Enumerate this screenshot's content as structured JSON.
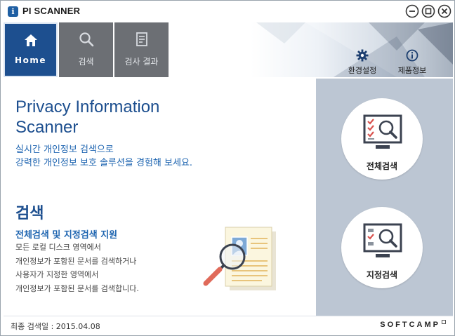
{
  "window": {
    "title": "PI SCANNER",
    "app_icon_glyph": "i"
  },
  "nav": {
    "tabs": [
      {
        "label": "Home",
        "icon": "home-icon",
        "active": true
      },
      {
        "label": "검색",
        "icon": "search-icon",
        "active": false
      },
      {
        "label": "검사 결과",
        "icon": "document-icon",
        "active": false
      }
    ]
  },
  "utilities": {
    "settings_label": "환경설정",
    "settings_icon": "gear-icon",
    "info_label": "제품정보",
    "info_icon": "info-icon"
  },
  "hero": {
    "title_line1": "Privacy Information",
    "title_line2": "Scanner",
    "sub_line1": "실시간 개인정보 검색으로",
    "sub_line2": "강력한 개인정보 보호 솔루션을 경험해 보세요."
  },
  "section": {
    "title": "검색",
    "subtitle": "전체검색 및 지정검색 지원",
    "desc": [
      "모든 로컬 디스크 영역에서",
      "개인정보가 포함된 문서를 검색하거나",
      "사용자가 지정한 영역에서",
      "개인정보가 포함된 문서를 검색합니다."
    ]
  },
  "actions": {
    "full_scan_label": "전체검색",
    "partial_scan_label": "지정검색"
  },
  "footer": {
    "last_scan": "최종 검색일 : 2015.04.08",
    "brand": "SOFTCAMP"
  },
  "colors": {
    "accent_blue": "#1d4f8f",
    "nav_gray": "#6c6f74",
    "side_panel": "#bcc6d3",
    "checkmark_red": "#d9534f"
  }
}
